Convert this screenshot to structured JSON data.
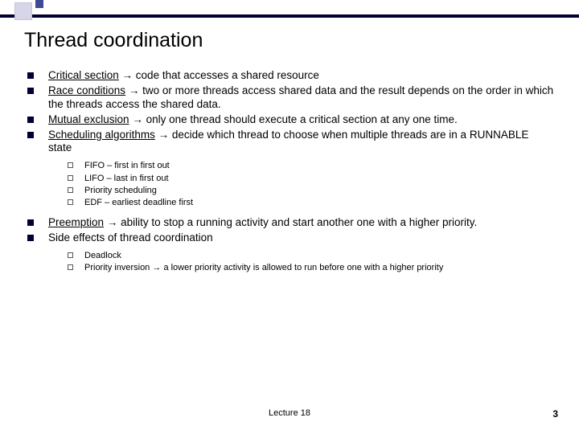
{
  "title": "Thread coordination",
  "bullets": [
    {
      "term": "Critical section",
      "arrow": "→",
      "rest": " code that accesses a shared resource"
    },
    {
      "term": "Race conditions",
      "arrow": "→",
      "rest": " two or more threads access shared data and the result depends on the order in which the threads access the shared data."
    },
    {
      "term": "Mutual exclusion",
      "arrow": "→",
      "rest": " only one thread should execute a critical section at any one time."
    },
    {
      "term": "Scheduling algorithms",
      "arrow": "→",
      "rest": " decide which thread to choose when multiple threads are in a RUNNABLE state"
    }
  ],
  "sched_sub": [
    "FIFO – first in first out",
    "LIFO – last in first out",
    "Priority scheduling",
    "EDF – earliest deadline first"
  ],
  "bullets2": [
    {
      "term": "Preemption",
      "arrow": "→",
      "rest": " ability to stop a running activity and start another one with a higher priority."
    },
    {
      "term": "Side effects of thread coordination",
      "arrow": "",
      "rest": ""
    }
  ],
  "side_sub": [
    {
      "text": "Deadlock",
      "arrow": "",
      "rest": ""
    },
    {
      "text": "Priority inversion",
      "arrow": " → ",
      "rest": "a lower priority activity is allowed to run before one with a higher priority"
    }
  ],
  "footer": "Lecture 18",
  "page": "3"
}
